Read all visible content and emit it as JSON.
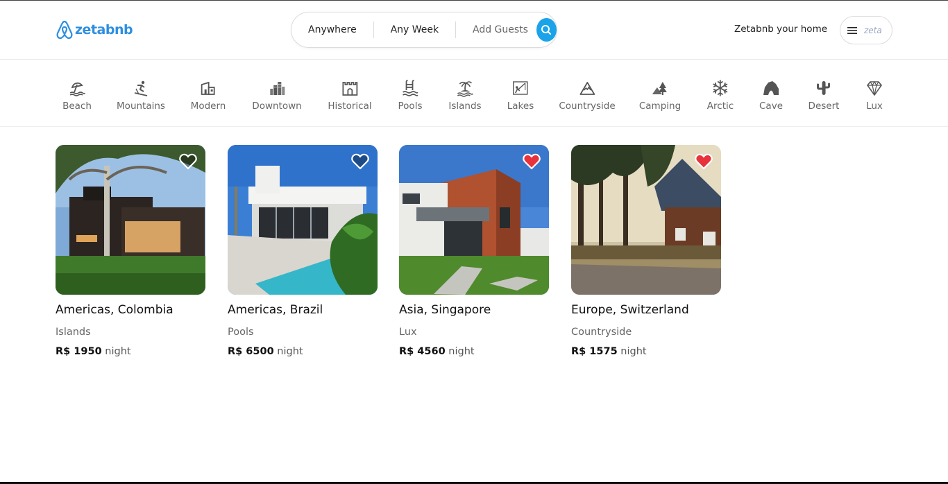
{
  "app": {
    "brand": "zetabnb",
    "accent": "#1aa3e8",
    "brand_color": "#2d8fe0"
  },
  "search": {
    "where": "Anywhere",
    "when": "Any Week",
    "guests": "Add Guests",
    "button_icon": "search-icon"
  },
  "header": {
    "host_link": "Zetabnb your home",
    "menu_icon": "hamburger-icon",
    "avatar_text": "zeta"
  },
  "categories": [
    {
      "label": "Beach",
      "icon": "beach-icon"
    },
    {
      "label": "Mountains",
      "icon": "skier-icon"
    },
    {
      "label": "Modern",
      "icon": "modern-house-icon"
    },
    {
      "label": "Downtown",
      "icon": "city-buildings-icon"
    },
    {
      "label": "Historical",
      "icon": "castle-icon"
    },
    {
      "label": "Pools",
      "icon": "pool-icon"
    },
    {
      "label": "Islands",
      "icon": "island-palm-icon"
    },
    {
      "label": "Lakes",
      "icon": "lake-fishing-icon"
    },
    {
      "label": "Countryside",
      "icon": "mountain-peak-icon"
    },
    {
      "label": "Camping",
      "icon": "tent-tree-icon"
    },
    {
      "label": "Arctic",
      "icon": "snowflake-icon"
    },
    {
      "label": "Cave",
      "icon": "cave-icon"
    },
    {
      "label": "Desert",
      "icon": "cactus-icon"
    },
    {
      "label": "Lux",
      "icon": "diamond-icon"
    }
  ],
  "listings": [
    {
      "location": "Americas, Colombia",
      "category": "Islands",
      "price": "R$ 1950",
      "unit": "night",
      "favorite": false
    },
    {
      "location": "Americas, Brazil",
      "category": "Pools",
      "price": "R$ 6500",
      "unit": "night",
      "favorite": false
    },
    {
      "location": "Asia, Singapore",
      "category": "Lux",
      "price": "R$ 4560",
      "unit": "night",
      "favorite": true
    },
    {
      "location": "Europe, Switzerland",
      "category": "Countryside",
      "price": "R$ 1575",
      "unit": "night",
      "favorite": true
    }
  ]
}
